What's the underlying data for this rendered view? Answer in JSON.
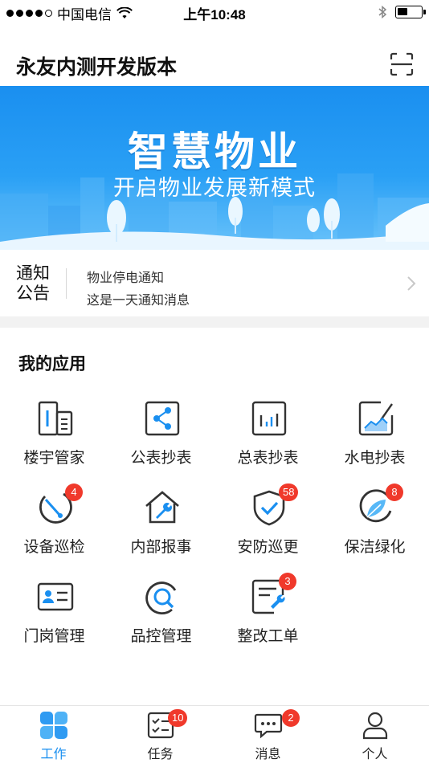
{
  "status_bar": {
    "carrier": "中国电信",
    "time": "上午10:48"
  },
  "header": {
    "title": "永友内测开发版本",
    "scan_icon": "scan-icon"
  },
  "banner": {
    "title": "智慧物业",
    "subtitle": "开启物业发展新模式"
  },
  "notice": {
    "label": "通知公告",
    "items": [
      "物业停电通知",
      "这是一天通知消息"
    ]
  },
  "apps": {
    "section_title": "我的应用",
    "items": [
      {
        "label": "楼宇管家",
        "icon": "building-icon",
        "badge": ""
      },
      {
        "label": "公表抄表",
        "icon": "share-meter-icon",
        "badge": ""
      },
      {
        "label": "总表抄表",
        "icon": "bar-chart-icon",
        "badge": ""
      },
      {
        "label": "水电抄表",
        "icon": "line-chart-icon",
        "badge": ""
      },
      {
        "label": "设备巡检",
        "icon": "gauge-icon",
        "badge": "4"
      },
      {
        "label": "内部报事",
        "icon": "house-wrench-icon",
        "badge": ""
      },
      {
        "label": "安防巡更",
        "icon": "shield-check-icon",
        "badge": "58"
      },
      {
        "label": "保洁绿化",
        "icon": "leaf-icon",
        "badge": "8"
      },
      {
        "label": "门岗管理",
        "icon": "id-card-icon",
        "badge": ""
      },
      {
        "label": "品控管理",
        "icon": "magnifier-icon",
        "badge": ""
      },
      {
        "label": "整改工单",
        "icon": "document-wrench-icon",
        "badge": "3"
      }
    ]
  },
  "tabbar": {
    "items": [
      {
        "label": "工作",
        "icon": "grid-flower-icon",
        "badge": "",
        "active": true
      },
      {
        "label": "任务",
        "icon": "checklist-icon",
        "badge": "10",
        "active": false
      },
      {
        "label": "消息",
        "icon": "chat-bubble-icon",
        "badge": "2",
        "active": false
      },
      {
        "label": "个人",
        "icon": "person-icon",
        "badge": "",
        "active": false
      }
    ]
  },
  "colors": {
    "accent": "#1a8ff0",
    "badge": "#f0392b",
    "banner_top": "#1a8ff0",
    "banner_bottom": "#6cc4fa"
  }
}
